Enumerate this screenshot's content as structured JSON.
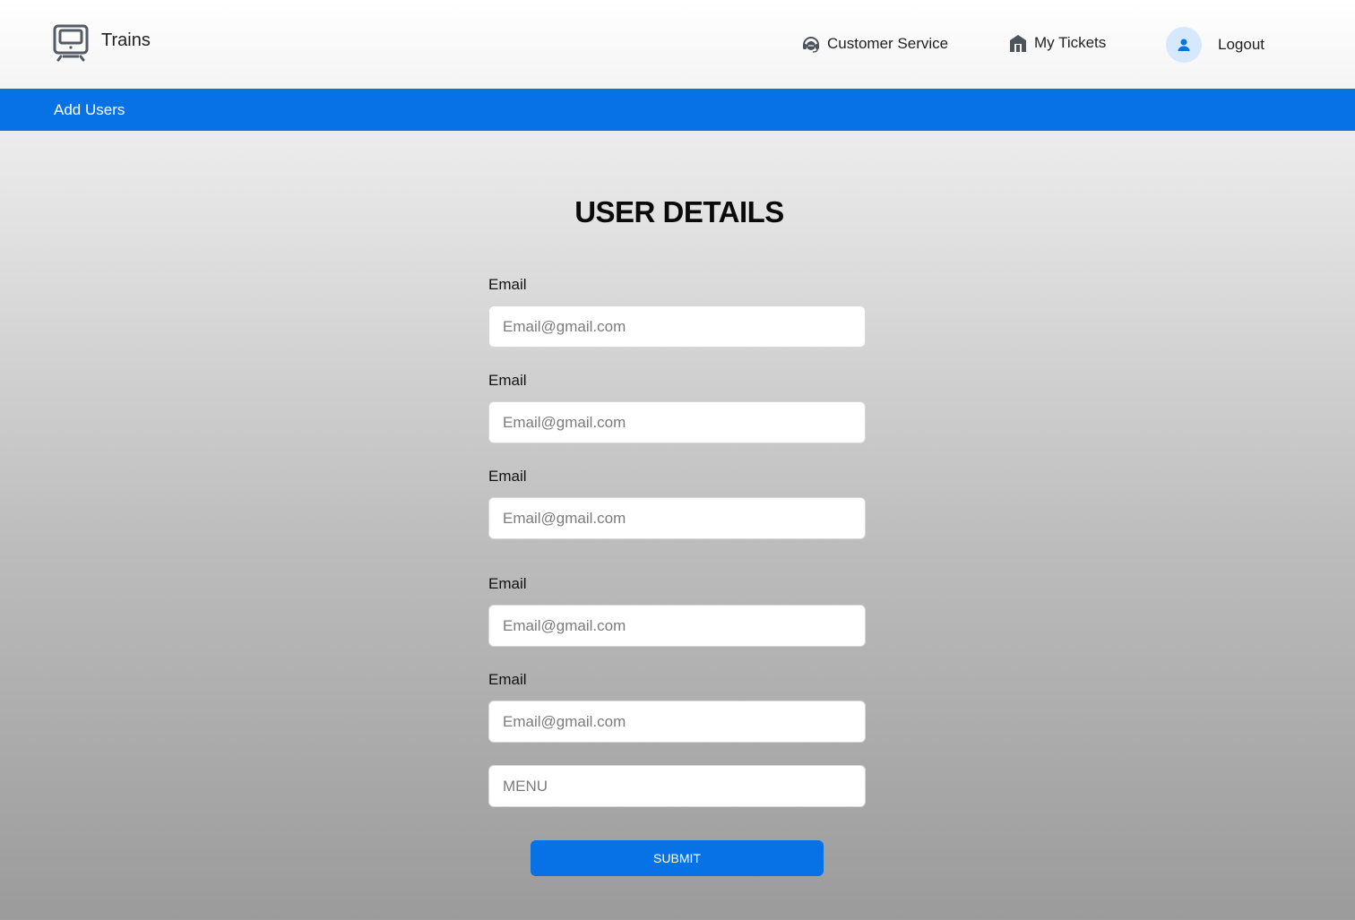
{
  "header": {
    "brand_name": "Trains",
    "brand_icon": "train-icon",
    "nav": {
      "customer_service_label": "Customer Service",
      "customer_service_icon": "headset-icon",
      "my_tickets_label": "My Tickets",
      "my_tickets_icon": "station-icon",
      "avatar_icon": "user-icon",
      "logout_label": "Logout"
    }
  },
  "subbar": {
    "title": "Add Users"
  },
  "form": {
    "title": "USER DETAILS",
    "fields": [
      {
        "label": "Email",
        "placeholder": "Email@gmail.com",
        "value": ""
      },
      {
        "label": "Email",
        "placeholder": "Email@gmail.com",
        "value": ""
      },
      {
        "label": "Email",
        "placeholder": "Email@gmail.com",
        "value": ""
      },
      {
        "label": "Email",
        "placeholder": "Email@gmail.com",
        "value": ""
      },
      {
        "label": "Email",
        "placeholder": "Email@gmail.com",
        "value": ""
      }
    ],
    "menu": {
      "placeholder": "MENU",
      "value": ""
    },
    "submit_label": "SUBMIT"
  },
  "colors": {
    "accent": "#0772e6",
    "avatar_bg": "#d6e8fb"
  }
}
